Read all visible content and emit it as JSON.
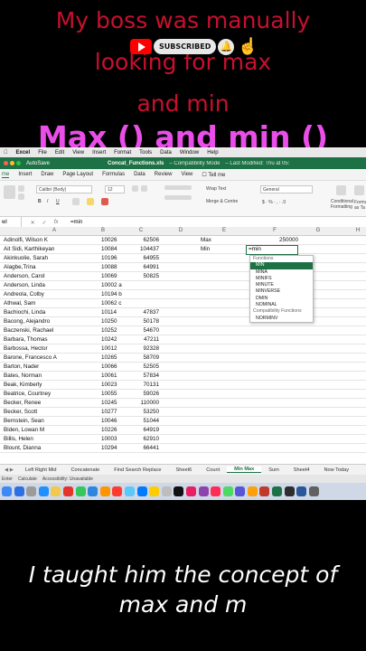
{
  "overlay": {
    "top_caption_lines": [
      "My boss was manually",
      "looking for max",
      "and min"
    ],
    "title": "Max () and min ()",
    "subscribed_label": "SUBSCRIBED",
    "bottom_caption_lines": [
      "I taught him the concept of",
      "max and m"
    ]
  },
  "app": {
    "menubar": [
      "Excel",
      "File",
      "Edit",
      "View",
      "Insert",
      "Format",
      "Tools",
      "Data",
      "Window",
      "Help"
    ],
    "autosave_label": "AutoSave",
    "file_title": "Concat_Functions.xls",
    "mode": "– Compatibility Mode",
    "last_modified": "– Last Modified: Thu at 05:",
    "ribbon_tabs": [
      "me",
      "Insert",
      "Draw",
      "Page Layout",
      "Formulas",
      "Data",
      "Review",
      "View",
      "☐ Tell me"
    ],
    "font_name": "Calibri (Body)",
    "font_size": "12",
    "number_format": "General",
    "wrap_text": "Wrap Text",
    "merge_center": "Merge & Centre",
    "conditional_formatting": "Conditional Formatting",
    "format_as": "Format as Ta"
  },
  "formula_bar": {
    "name_box": "wl",
    "content": "=min"
  },
  "columns": [
    "A",
    "B",
    "C",
    "D",
    "E",
    "F",
    "G",
    "H"
  ],
  "rows": [
    {
      "name": "Adinolfi, Wilson  K",
      "id": "10026",
      "val": "62506"
    },
    {
      "name": "Ait Sidi, Karthikeyan",
      "id": "10084",
      "val": "104437"
    },
    {
      "name": "Akinkuolie, Sarah",
      "id": "10196",
      "val": "64955"
    },
    {
      "name": "Alagbe,Trina",
      "id": "10088",
      "val": "64991"
    },
    {
      "name": "Anderson, Carol",
      "id": "10069",
      "val": "50825"
    },
    {
      "name": "Anderson, Linda",
      "id": "10002 a",
      "val": ""
    },
    {
      "name": "Andreola, Colby",
      "id": "10194 b",
      "val": ""
    },
    {
      "name": "Athwal, Sam",
      "id": "10062 c",
      "val": ""
    },
    {
      "name": "Bachiochi, Linda",
      "id": "10114",
      "val": "47837"
    },
    {
      "name": "Bacong, Alejandro",
      "id": "10250",
      "val": "50178"
    },
    {
      "name": "Baczenski, Rachael",
      "id": "10252",
      "val": "54670"
    },
    {
      "name": "Barbara, Thomas",
      "id": "10242",
      "val": "47211"
    },
    {
      "name": "Barbossa, Hector",
      "id": "10012",
      "val": "92328"
    },
    {
      "name": "Barone, Francesco  A",
      "id": "10265",
      "val": "58709"
    },
    {
      "name": "Barton, Nader",
      "id": "10066",
      "val": "52505"
    },
    {
      "name": "Bates, Norman",
      "id": "10061",
      "val": "57834"
    },
    {
      "name": "Beak, Kimberly",
      "id": "10023",
      "val": "70131"
    },
    {
      "name": "Beatrice, Courtney",
      "id": "10055",
      "val": "59026"
    },
    {
      "name": "Becker, Renee",
      "id": "10245",
      "val": "110000"
    },
    {
      "name": "Becker, Scott",
      "id": "10277",
      "val": "53250"
    },
    {
      "name": "Bernstein, Sean",
      "id": "10046",
      "val": "51044"
    },
    {
      "name": "Biden, Lowan  M",
      "id": "10226",
      "val": "64919"
    },
    {
      "name": "Billis, Helen",
      "id": "10003",
      "val": "62910"
    },
    {
      "name": "Blount, Dianna",
      "id": "10294",
      "val": "66441"
    }
  ],
  "summary": {
    "max_label": "Max",
    "max_value": "250000",
    "min_label": "Min",
    "min_formula": "=min"
  },
  "autocomplete": {
    "header": "Functions",
    "items": [
      "MIN",
      "MINA",
      "MINIFS",
      "MINUTE",
      "MINVERSE",
      "DMIN",
      "NOMINAL"
    ],
    "compat_header": "Compatibility Functions",
    "compat_items": [
      "NORMINV"
    ]
  },
  "sheet_tabs": [
    "Left Right Mid",
    "Concatenate",
    "Find Search Replace",
    "Sheet6",
    "Count",
    "Min Max",
    "Sum",
    "Sheet4",
    "Now Today"
  ],
  "active_sheet": "Min Max",
  "status": [
    "Enter",
    "Calculate",
    "Accessibility: Unavailable"
  ],
  "dock_colors": [
    "#3d8af7",
    "#2f6fe4",
    "#9b9b9b",
    "#1e90ff",
    "#f2c94c",
    "#e5332a",
    "#34c759",
    "#2e86de",
    "#ff9500",
    "#ff3b30",
    "#5ac8fa",
    "#007aff",
    "#ffcc00",
    "#bdbdbd",
    "#111111",
    "#e91e63",
    "#8e44ad",
    "#ff2d55",
    "#4cd964",
    "#5856d6",
    "#ff9f0a",
    "#c0392b",
    "#1e7145",
    "#2d2d2d",
    "#2b579a",
    "#616161"
  ]
}
